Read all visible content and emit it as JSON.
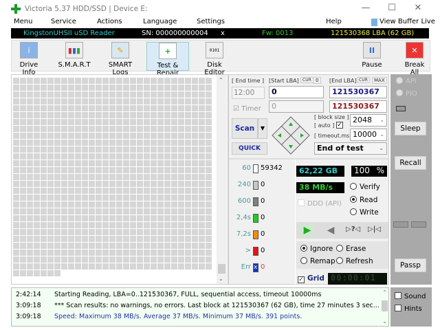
{
  "window": {
    "title": "Victoria 5.37 HDD/SSD | Device E:",
    "minimize": "—",
    "maximize": "☐",
    "close": "✕"
  },
  "menu": {
    "items": [
      "Menu",
      "Service",
      "Actions",
      "Language",
      "Settings",
      "Help"
    ],
    "view_buffer": "View Buffer Live"
  },
  "infobar": {
    "model": "KingstonUHSII uSD Reader",
    "sn": "SN: 000000000004",
    "x": "x",
    "fw": "Fw: 0013",
    "lba": "121530368 LBA (62 GB)",
    "colors": {
      "model": "#3cc",
      "fw": "#3c3",
      "lba": "#ee3"
    }
  },
  "toolbar": {
    "drive_info": "Drive Info",
    "smart": "S.M.A.R.T",
    "smart_logs": "SMART Logs",
    "test_repair": "Test & Repair",
    "disk_editor": "Disk Editor",
    "pause": "Pause",
    "break_all": "Break All"
  },
  "controls": {
    "end_time_label": "[ End time ]",
    "end_time": "12:00",
    "timer_label": "Timer",
    "start_lba_label": "[Start LBA]",
    "cur": "CUR",
    "zero": "0",
    "start_lba": "0",
    "start_lba2": "0",
    "end_lba_label": "[End LBA]",
    "max": "MAX",
    "end_lba": "121530367",
    "end_lba2": "121530367",
    "block_size_label": "[ block size ]",
    "auto_label": "[ auto ]",
    "timeout_label": "[ timeout.ms ]",
    "block_size": "2048",
    "timeout": "10000",
    "end_action": "End of test",
    "scan": "Scan",
    "quick": "QUICK"
  },
  "legend": [
    {
      "label": "60",
      "count": "59342",
      "color": "#ffffff"
    },
    {
      "label": "240",
      "count": "0",
      "color": "#c8c8c8"
    },
    {
      "label": "600",
      "count": "0",
      "color": "#808080"
    },
    {
      "label": "2,4s",
      "count": "0",
      "color": "#22cc22"
    },
    {
      "label": "7,2s",
      "count": "0",
      "color": "#ff8800"
    },
    {
      "label": ">",
      "count": "0",
      "color": "#ee1111"
    },
    {
      "label": "Err",
      "count": "0",
      "color": "#1133cc"
    }
  ],
  "status": {
    "size": "62,22 GB",
    "percent": "100",
    "percent_sign": "%",
    "speed": "38 MB/s",
    "ddd": "DDD (API)",
    "verify": "Verify",
    "read": "Read",
    "write": "Write",
    "mode": "Read"
  },
  "repair": {
    "ignore": "Ignore",
    "erase": "Erase",
    "remap": "Remap",
    "refresh": "Refresh",
    "selected": "Ignore"
  },
  "grid_label": "Grid",
  "elapsed": "00:00:01",
  "right_panel": {
    "api": "API",
    "pio": "PIO",
    "sleep": "Sleep",
    "recall": "Recall",
    "passp": "Passp"
  },
  "log": [
    {
      "time": "2:42:14",
      "msg": "Starting Reading, LBA=0..121530367, FULL, sequential access, timeout 10000ms",
      "color": "#000"
    },
    {
      "time": "3:09:18",
      "msg": "*** Scan results: no warnings, no errors. Last block at 121530367 (62 GB), time 27 minutes 3 sec...",
      "color": "#000"
    },
    {
      "time": "3:09:18",
      "msg": "Speed: Maximum 38 MB/s. Average 37 MB/s. Minimum 37 MB/s. 391 points.",
      "color": "#2233aa"
    }
  ],
  "log_side": {
    "sound": "Sound",
    "hints": "Hints"
  }
}
